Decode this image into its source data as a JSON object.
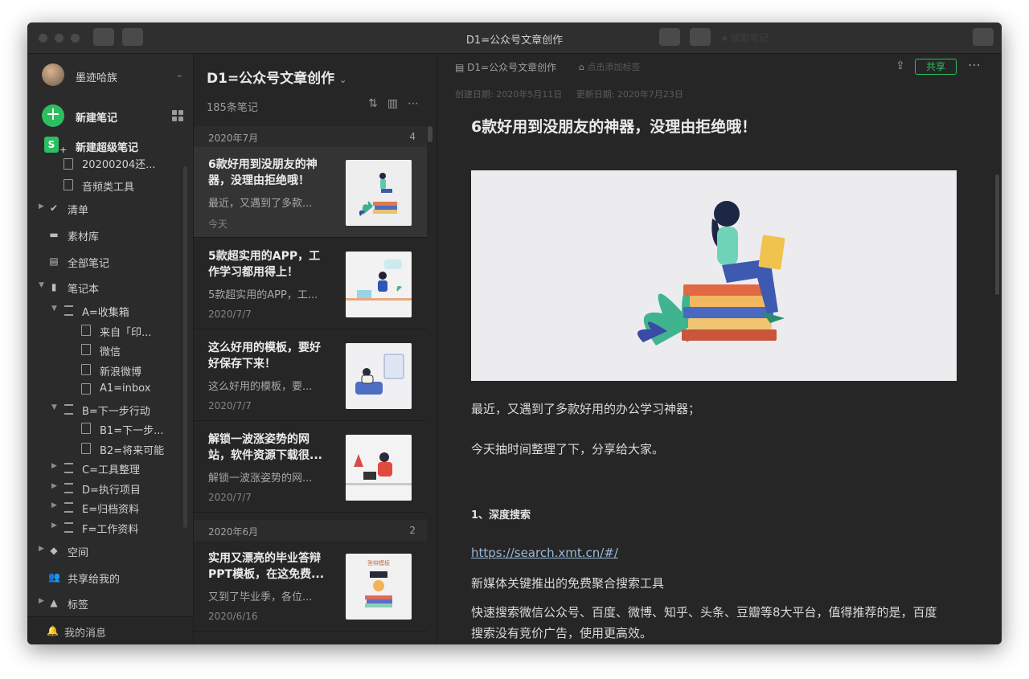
{
  "window": {
    "title": "D1=公众号文章创作",
    "search_placeholder": "搜索笔记"
  },
  "sidebar": {
    "user_name": "墨迹哈族",
    "new_note": "新建笔记",
    "new_super_note": "新建超级笔记",
    "recent_items": [
      "20200204还...",
      "音频类工具"
    ],
    "items": [
      {
        "label": "清单"
      },
      {
        "label": "素材库"
      },
      {
        "label": "全部笔记"
      },
      {
        "label": "笔记本"
      }
    ],
    "notebooks": [
      {
        "label": "A=收集箱",
        "children": [
          "来自「印...",
          "微信",
          "新浪微博",
          "A1=inbox"
        ]
      },
      {
        "label": "B=下一步行动",
        "children": [
          "B1=下一步...",
          "B2=将来可能"
        ]
      },
      {
        "label": "C=工具整理"
      },
      {
        "label": "D=执行项目"
      },
      {
        "label": "E=归档资料"
      },
      {
        "label": "F=工作资料"
      }
    ],
    "space": "空间",
    "shared_with_me": "共享给我的",
    "tags": "标签",
    "messages": "我的消息"
  },
  "notelist": {
    "title": "D1=公众号文章创作",
    "count": "185条笔记",
    "groups": [
      {
        "month": "2020年7月",
        "count": "4",
        "notes": [
          {
            "title": "6款好用到没朋友的神器，没理由拒绝哦！",
            "snippet": "最近，又遇到了多款...",
            "date": "今天"
          },
          {
            "title": "5款超实用的APP，工作学习都用得上！",
            "snippet": "5款超实用的APP，工...",
            "date": "2020/7/7"
          },
          {
            "title": "这么好用的模板，要好好保存下来！",
            "snippet": "这么好用的模板，要...",
            "date": "2020/7/7"
          },
          {
            "title": "解锁一波涨姿势的网站，软件资源下载很...",
            "snippet": "解锁一波涨姿势的网...",
            "date": "2020/7/7"
          }
        ]
      },
      {
        "month": "2020年6月",
        "count": "2",
        "notes": [
          {
            "title": "实用又漂亮的毕业答辩PPT模板，在这免费...",
            "snippet": "又到了毕业季，各位...",
            "date": "2020/6/16",
            "thumb_label": "答辩模板"
          }
        ]
      }
    ]
  },
  "editor": {
    "breadcrumb": "D1=公众号文章创作",
    "add_tag": "点击添加标签",
    "share": "共享",
    "created": "创建日期: 2020年5月11日",
    "updated": "更新日期: 2020年7月23日",
    "heading": "6款好用到没朋友的神器，没理由拒绝哦！",
    "p1": "最近，又遇到了多款好用的办公学习神器；",
    "p2": "今天抽时间整理了下，分享给大家。",
    "section1": "1、深度搜索",
    "link": "https://search.xmt.cn/#/",
    "p3": "新媒体关键推出的免费聚合搜索工具",
    "p4": "快速搜索微信公众号、百度、微博、知乎、头条、豆瓣等8大平台，值得推荐的是，百度搜索没有竞价广告，使用更高效。"
  },
  "colors": {
    "accent_green": "#2dbe60",
    "window_bg": "#252525",
    "link": "#9ab8d8"
  }
}
